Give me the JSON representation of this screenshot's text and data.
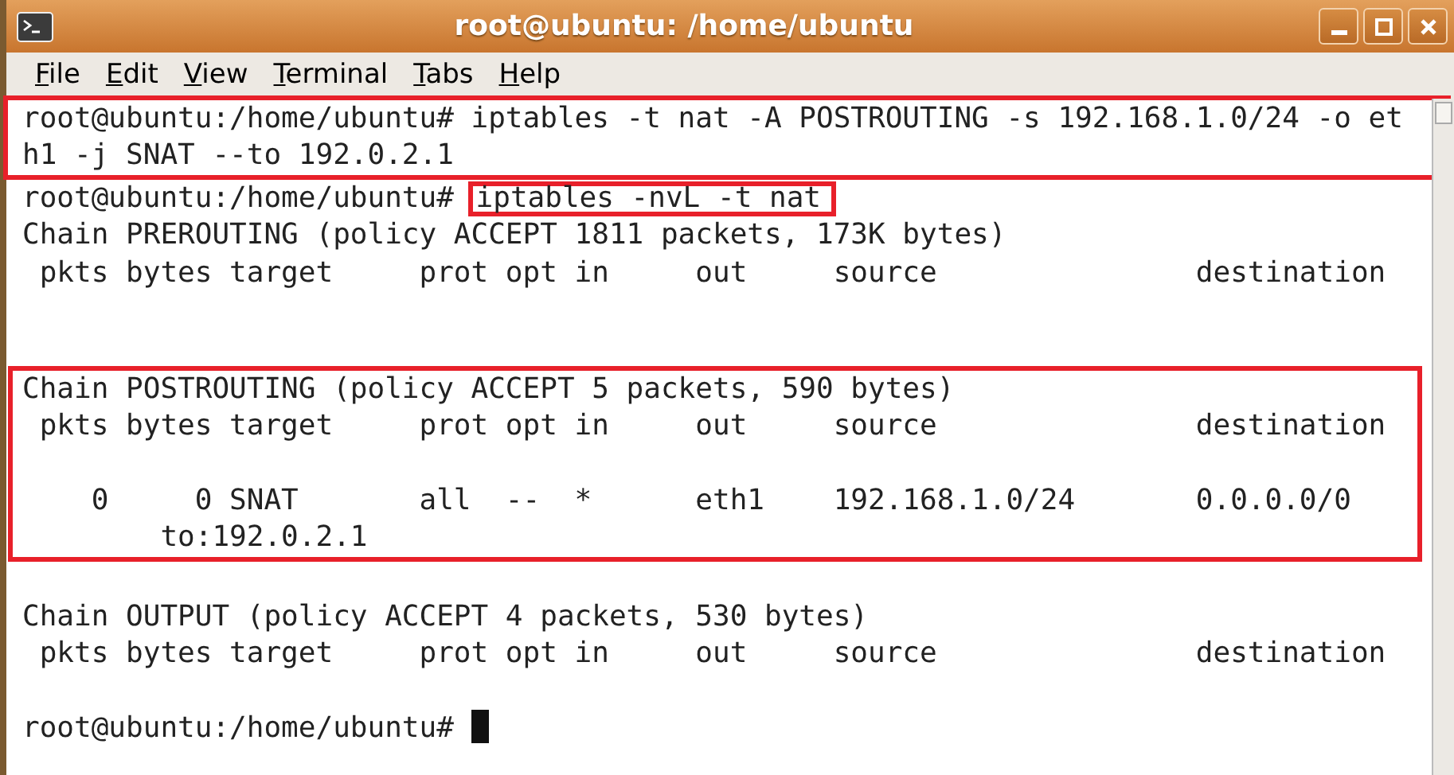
{
  "window": {
    "title": "root@ubuntu: /home/ubuntu"
  },
  "menu": [
    {
      "label": "File"
    },
    {
      "label": "Edit"
    },
    {
      "label": "View"
    },
    {
      "label": "Terminal"
    },
    {
      "label": "Tabs"
    },
    {
      "label": "Help"
    }
  ],
  "terminal": {
    "blocks": [
      {
        "kind": "highlight",
        "children": [
          {
            "kind": "text",
            "text": "root@ubuntu:/home/ubuntu# iptables -t nat -A POSTROUTING -s 192.168.1.0/24 -o et"
          },
          {
            "kind": "text",
            "text": "h1 -j SNAT --to 192.0.2.1"
          }
        ]
      },
      {
        "kind": "prompt",
        "prompt": "root@ubuntu:/home/ubuntu#",
        "command": "iptables -nvL -t nat",
        "highlighted": true
      },
      {
        "kind": "text",
        "text": "Chain PREROUTING (policy ACCEPT 1811 packets, 173K bytes)"
      },
      {
        "kind": "text",
        "text": " pkts bytes target     prot opt in     out     source               destination"
      },
      {
        "kind": "blank"
      },
      {
        "kind": "blank"
      },
      {
        "kind": "highlight",
        "children": [
          {
            "kind": "text",
            "text": "Chain POSTROUTING (policy ACCEPT 5 packets, 590 bytes)"
          },
          {
            "kind": "text",
            "text": " pkts bytes target     prot opt in     out     source               destination"
          },
          {
            "kind": "blank"
          },
          {
            "kind": "text",
            "text": "    0     0 SNAT       all  --  *      eth1    192.168.1.0/24       0.0.0.0/0"
          },
          {
            "kind": "text",
            "text": "        to:192.0.2.1"
          }
        ]
      },
      {
        "kind": "blank"
      },
      {
        "kind": "text",
        "text": "Chain OUTPUT (policy ACCEPT 4 packets, 530 bytes)"
      },
      {
        "kind": "text",
        "text": " pkts bytes target     prot opt in     out     source               destination"
      },
      {
        "kind": "blank"
      },
      {
        "kind": "prompt",
        "prompt": "root@ubuntu:/home/ubuntu#",
        "cursor": true
      }
    ]
  }
}
